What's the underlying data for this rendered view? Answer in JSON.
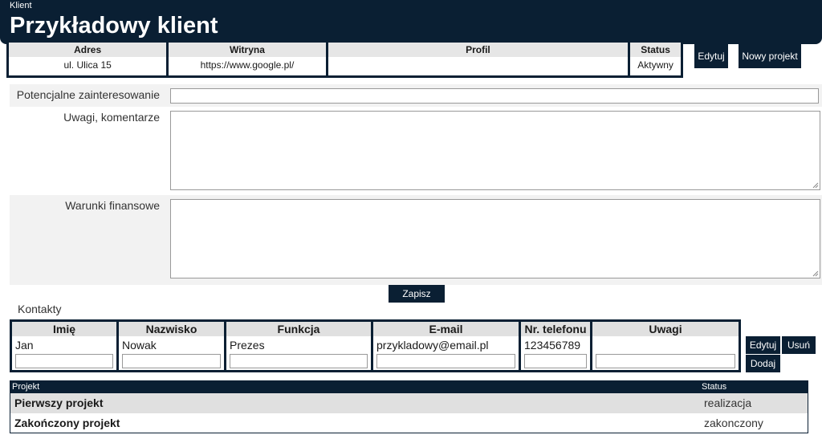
{
  "header": {
    "breadcrumb": "Klient",
    "title": "Przykładowy klient"
  },
  "info": {
    "columns": [
      {
        "label": "Adres",
        "value": "ul. Ulica 15"
      },
      {
        "label": "Witryna",
        "value": "https://www.google.pl/"
      },
      {
        "label": "Profil",
        "value": ""
      },
      {
        "label": "Status",
        "value": "Aktywny"
      }
    ],
    "edit_label": "Edytuj",
    "new_project_label": "Nowy projekt"
  },
  "form": {
    "interest_label": "Potencjalne zainteresowanie",
    "interest_value": "",
    "comments_label": "Uwagi, komentarze",
    "comments_value": "",
    "finance_label": "Warunki finansowe",
    "finance_value": "",
    "save_label": "Zapisz"
  },
  "contacts": {
    "label": "Kontakty",
    "columns": [
      {
        "label": "Imię",
        "value": "Jan"
      },
      {
        "label": "Nazwisko",
        "value": "Nowak"
      },
      {
        "label": "Funkcja",
        "value": "Prezes"
      },
      {
        "label": "E-mail",
        "value": "przykladowy@email.pl"
      },
      {
        "label": "Nr. telefonu",
        "value": "123456789"
      },
      {
        "label": "Uwagi",
        "value": ""
      }
    ],
    "edit_label": "Edytuj",
    "delete_label": "Usuń",
    "add_label": "Dodaj"
  },
  "projects": {
    "col_project": "Projekt",
    "col_status": "Status",
    "rows": [
      {
        "name": "Pierwszy projekt",
        "status": "realizacja"
      },
      {
        "name": "Zakończony projekt",
        "status": "zakonczony"
      }
    ]
  }
}
